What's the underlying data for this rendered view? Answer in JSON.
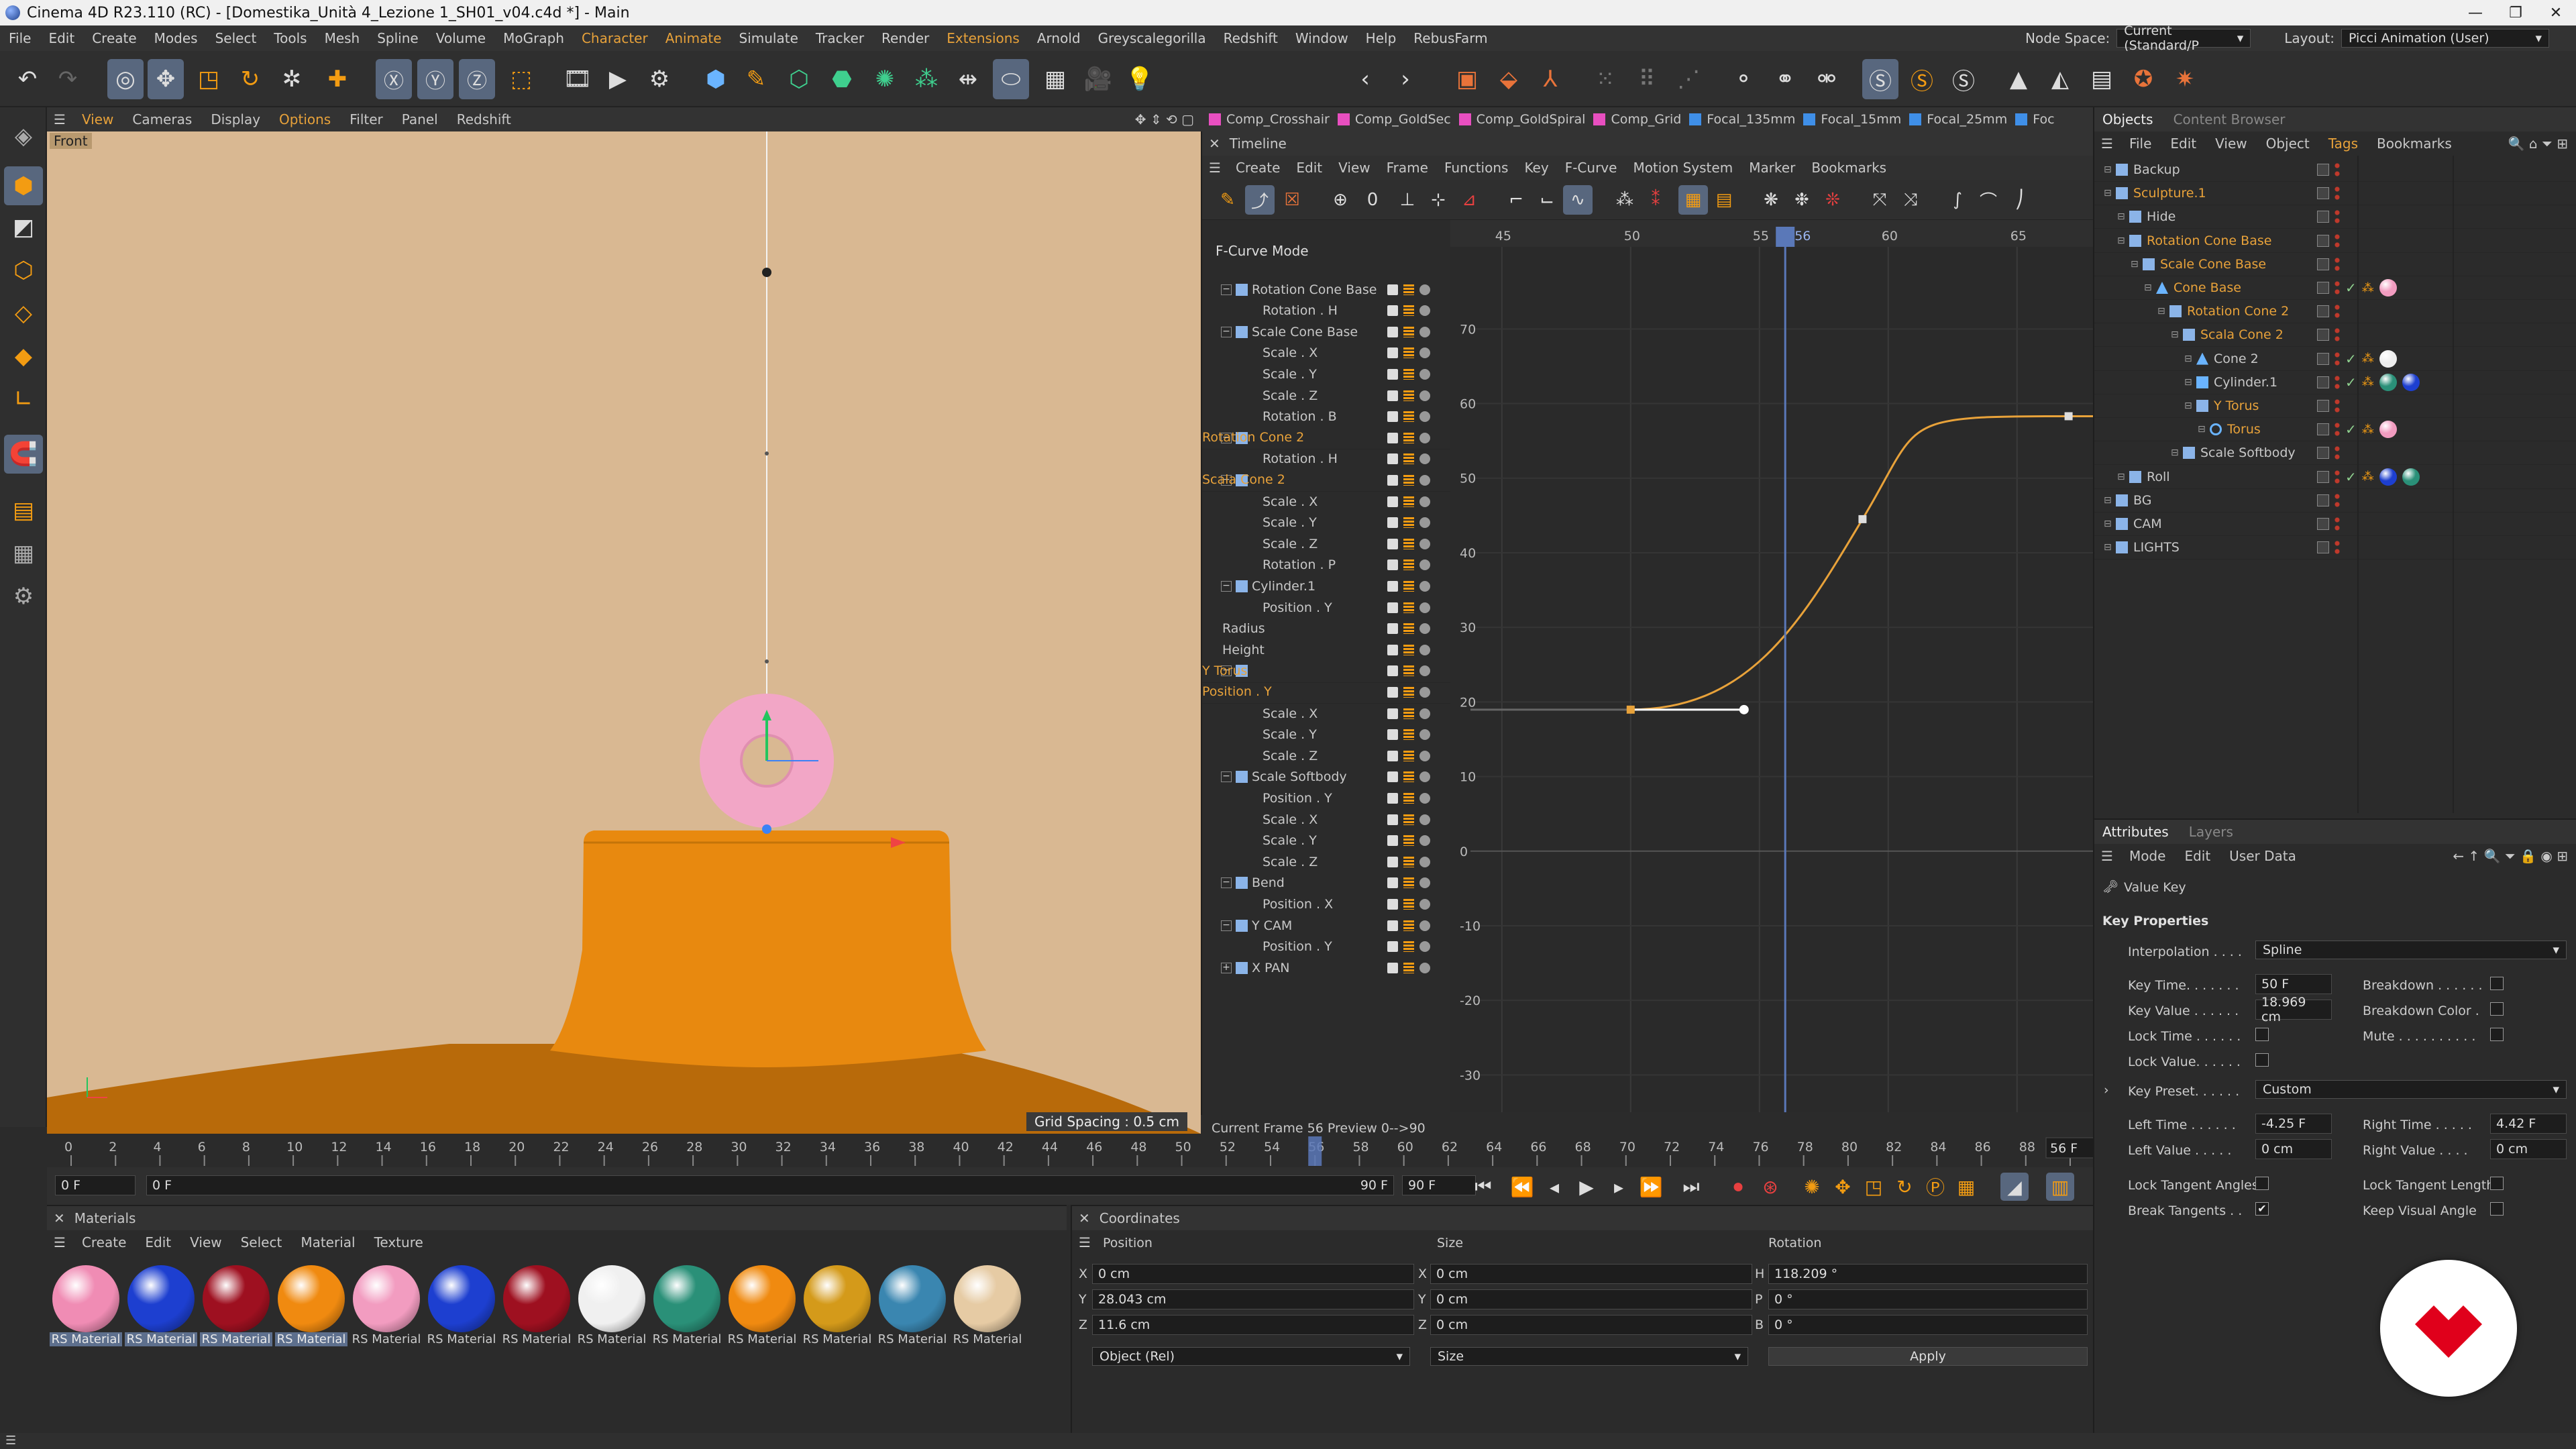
{
  "window": {
    "title": "Cinema 4D R23.110 (RC) - [Domestika_Unità 4_Lezione 1_SH01_v04.c4d *] - Main"
  },
  "menubar": {
    "items": [
      "File",
      "Edit",
      "Create",
      "Modes",
      "Select",
      "Tools",
      "Mesh",
      "Spline",
      "Volume",
      "MoGraph",
      "Character",
      "Animate",
      "Simulate",
      "Tracker",
      "Render",
      "Extensions",
      "Arnold",
      "Greyscalegorilla",
      "Redshift",
      "Window",
      "Help",
      "RebusFarm"
    ],
    "node_space_label": "Node Space:",
    "node_space_value": "Current (Standard/P",
    "layout_label": "Layout:",
    "layout_value": "Picci Animation (User)"
  },
  "viewport": {
    "menu": [
      "View",
      "Cameras",
      "Display",
      "Options",
      "Filter",
      "Panel",
      "Redshift"
    ],
    "view_name": "Front",
    "grid_spacing": "Grid Spacing : 0.5 cm",
    "bg_color": "#d9b892",
    "torus_color": "#f2a6c6",
    "base_color": "#e8890f"
  },
  "tabs": [
    "Comp_Crosshair",
    "Comp_GoldSec",
    "Comp_GoldSpiral",
    "Comp_Grid",
    "Focal_135mm",
    "Focal_15mm",
    "Focal_25mm",
    "Foc"
  ],
  "timeline": {
    "title": "Timeline",
    "menu": [
      "Create",
      "Edit",
      "View",
      "Frame",
      "Functions",
      "Key",
      "F-Curve",
      "Motion System",
      "Marker",
      "Bookmarks"
    ],
    "mode": "F-Curve Mode",
    "tracks": [
      {
        "name": "Rotation Cone Base",
        "level": 0,
        "exp": "−",
        "obj": true,
        "color": "n"
      },
      {
        "name": "Rotation . H",
        "level": 1
      },
      {
        "name": "Scale Cone Base",
        "level": 0,
        "exp": "−",
        "obj": true,
        "color": "n"
      },
      {
        "name": "Scale . X",
        "level": 1
      },
      {
        "name": "Scale . Y",
        "level": 1
      },
      {
        "name": "Scale . Z",
        "level": 1
      },
      {
        "name": "Rotation . B",
        "level": 1
      },
      {
        "name": "Rotation Cone 2",
        "level": 0,
        "exp": "−",
        "obj": true,
        "color": "o"
      },
      {
        "name": "Rotation . H",
        "level": 1
      },
      {
        "name": "Scala Cone 2",
        "level": 0,
        "exp": "−",
        "obj": true,
        "color": "o"
      },
      {
        "name": "Scale . X",
        "level": 1
      },
      {
        "name": "Scale . Y",
        "level": 1
      },
      {
        "name": "Scale . Z",
        "level": 1
      },
      {
        "name": "Rotation . P",
        "level": 1
      },
      {
        "name": "Cylinder.1",
        "level": 0,
        "exp": "−",
        "obj": true,
        "color": "n"
      },
      {
        "name": "Position . Y",
        "level": 1
      },
      {
        "name": "Radius",
        "level": 2
      },
      {
        "name": "Height",
        "level": 2
      },
      {
        "name": "Y Torus",
        "level": 0,
        "exp": "−",
        "obj": true,
        "color": "o"
      },
      {
        "name": "Position . Y",
        "level": 1,
        "color": "o"
      },
      {
        "name": "Scale . X",
        "level": 1
      },
      {
        "name": "Scale . Y",
        "level": 1
      },
      {
        "name": "Scale . Z",
        "level": 1
      },
      {
        "name": "Scale Softbody",
        "level": 0,
        "exp": "−",
        "obj": true,
        "color": "n"
      },
      {
        "name": "Position . Y",
        "level": 1
      },
      {
        "name": "Scale . X",
        "level": 1
      },
      {
        "name": "Scale . Y",
        "level": 1
      },
      {
        "name": "Scale . Z",
        "level": 1
      },
      {
        "name": "Bend",
        "level": 0,
        "exp": "−",
        "obj": true,
        "color": "n"
      },
      {
        "name": "Position . X",
        "level": 1
      },
      {
        "name": "Y CAM",
        "level": 0,
        "exp": "−",
        "obj": true,
        "color": "n"
      },
      {
        "name": "Position . Y",
        "level": 1
      },
      {
        "name": "X PAN",
        "level": 0,
        "exp": "+",
        "obj": true,
        "color": "n"
      }
    ],
    "current_frame_text": "Current Frame  56  Preview  0-->90",
    "graph": {
      "x_ticks": [
        45,
        50,
        55,
        60,
        65
      ],
      "y_ticks": [
        70,
        60,
        50,
        40,
        30,
        20,
        10,
        0,
        -10,
        -20,
        -30
      ],
      "x_range": [
        43,
        68
      ],
      "y_range": [
        -35,
        81
      ],
      "current_frame": 56,
      "playhead_label": "56",
      "curve_color": "#e8a23a",
      "keys": [
        {
          "frame": 50,
          "value": 18.969
        },
        {
          "frame": 59,
          "value": 44.5
        },
        {
          "frame": 67,
          "value": 58.3
        }
      ],
      "tangent_handle": {
        "frame": 54.4,
        "value": 18.969
      }
    }
  },
  "scrubber": {
    "ticks": [
      0,
      2,
      4,
      6,
      8,
      10,
      12,
      14,
      16,
      18,
      20,
      22,
      24,
      26,
      28,
      30,
      32,
      34,
      36,
      38,
      40,
      42,
      44,
      46,
      48,
      50,
      52,
      54,
      56,
      58,
      60,
      62,
      64,
      66,
      68,
      70,
      72,
      74,
      76,
      78,
      80,
      82,
      84,
      86,
      88,
      90
    ],
    "range": [
      0,
      90
    ],
    "current_frame": 56,
    "current_label": "56 F",
    "start_field": "0 F",
    "start_field2": "0 F",
    "end_field": "90 F",
    "end_field2": "90 F"
  },
  "materials": {
    "title": "Materials",
    "menu": [
      "Create",
      "Edit",
      "View",
      "Select",
      "Material",
      "Texture"
    ],
    "items": [
      {
        "label": "RS Material",
        "color": "#f08cb4",
        "sel": true
      },
      {
        "label": "RS Material",
        "color": "#1d3fd0",
        "sel": true
      },
      {
        "label": "RS Material",
        "color": "#9e1020",
        "sel": true
      },
      {
        "label": "RS Material",
        "color": "#f08a10",
        "sel": true
      },
      {
        "label": "RS Material",
        "color": "#f29cc0",
        "sel": false
      },
      {
        "label": "RS Material",
        "color": "#1d3fd0",
        "sel": false
      },
      {
        "label": "RS Material",
        "color": "#9e1020",
        "sel": false
      },
      {
        "label": "RS Material",
        "color": "#f0f0f0",
        "sel": false
      },
      {
        "label": "RS Material",
        "color": "#2a9078",
        "sel": false
      },
      {
        "label": "RS Material",
        "color": "#f08a10",
        "sel": false
      },
      {
        "label": "RS Material",
        "color": "#d49a1a",
        "sel": false
      },
      {
        "label": "RS Material",
        "color": "#3a86b0",
        "sel": false
      },
      {
        "label": "RS Material",
        "color": "#e6cba4",
        "sel": false
      }
    ]
  },
  "coordinates": {
    "title": "Coordinates",
    "headers": {
      "position": "Position",
      "size": "Size",
      "rotation": "Rotation"
    },
    "rows": [
      {
        "axis": "X",
        "pos": "0 cm",
        "size_axis": "X",
        "size": "0 cm",
        "rot_axis": "H",
        "rot": "118.209 °"
      },
      {
        "axis": "Y",
        "pos": "28.043 cm",
        "size_axis": "Y",
        "size": "0 cm",
        "rot_axis": "P",
        "rot": "0 °"
      },
      {
        "axis": "Z",
        "pos": "11.6 cm",
        "size_axis": "Z",
        "size": "0 cm",
        "rot_axis": "B",
        "rot": "0 °"
      }
    ],
    "mode_select": "Object (Rel)",
    "size_select": "Size",
    "apply": "Apply"
  },
  "objects": {
    "tabs": [
      "Objects",
      "Content Browser"
    ],
    "menu": [
      "File",
      "Edit",
      "View",
      "Object",
      "Tags",
      "Bookmarks"
    ],
    "rows": [
      {
        "name": "Backup",
        "level": 0,
        "ico": "null",
        "o": false,
        "tags": []
      },
      {
        "name": "Sculpture.1",
        "level": 0,
        "ico": "null",
        "o": true,
        "tags": []
      },
      {
        "name": "Hide",
        "level": 1,
        "ico": "null",
        "o": false,
        "tags": []
      },
      {
        "name": "Rotation Cone Base",
        "level": 1,
        "ico": "null",
        "o": true,
        "tags": []
      },
      {
        "name": "Scale Cone Base",
        "level": 2,
        "ico": "null",
        "o": true,
        "tags": []
      },
      {
        "name": "Cone Base",
        "level": 3,
        "ico": "cone",
        "o": true,
        "check": true,
        "tags": [
          "#f29cc0"
        ]
      },
      {
        "name": "Rotation Cone 2",
        "level": 4,
        "ico": "null",
        "o": true,
        "tags": []
      },
      {
        "name": "Scala Cone 2",
        "level": 5,
        "ico": "null",
        "o": true,
        "tags": []
      },
      {
        "name": "Cone 2",
        "level": 6,
        "ico": "cone",
        "o": false,
        "check": true,
        "tags": [
          "#eeeeee"
        ]
      },
      {
        "name": "Cylinder.1",
        "level": 6,
        "ico": "cyl",
        "o": false,
        "check": true,
        "tags": [
          "#2a9078",
          "#1d3fd0"
        ]
      },
      {
        "name": "Y Torus",
        "level": 6,
        "ico": "null",
        "o": true,
        "tags": []
      },
      {
        "name": "Torus",
        "level": 7,
        "ico": "torus",
        "o": true,
        "check": true,
        "tags": [
          "#f29cc0"
        ]
      },
      {
        "name": "Scale Softbody",
        "level": 5,
        "ico": "null",
        "o": false,
        "tags": []
      },
      {
        "name": "Roll",
        "level": 1,
        "ico": "null",
        "o": false,
        "check": true,
        "tags": [
          "#1d3fd0",
          "#2a9078"
        ]
      },
      {
        "name": "BG",
        "level": 0,
        "ico": "null",
        "o": false,
        "tags": []
      },
      {
        "name": "CAM",
        "level": 0,
        "ico": "null",
        "o": false,
        "tags": []
      },
      {
        "name": "LIGHTS",
        "level": 0,
        "ico": "null",
        "o": false,
        "tags": []
      }
    ]
  },
  "attributes": {
    "tabs": [
      "Attributes",
      "Layers"
    ],
    "menu": [
      "Mode",
      "Edit",
      "User Data"
    ],
    "header": "Value Key",
    "section": "Key Properties",
    "interpolation_label": "Interpolation . . . .",
    "interpolation_value": "Spline",
    "key_time_label": "Key Time. . . . . . .",
    "key_time_value": "50 F",
    "key_value_label": "Key Value . . . . . .",
    "key_value_value": "18.969 cm",
    "lock_time_label": "Lock Time . . . . . .",
    "lock_value_label": "Lock Value. . . . . .",
    "breakdown_label": "Breakdown . . . . . .",
    "breakdown_color_label": "Breakdown Color .",
    "mute_label": "Mute . . . . . . . . . .",
    "key_preset_label": "Key Preset. . . . . .",
    "key_preset_value": "Custom",
    "left_time_label": "Left  Time . . . . . .",
    "left_time_value": "-4.25 F",
    "right_time_label": "Right Time . . . . .",
    "right_time_value": "4.42 F",
    "left_value_label": "Left  Value . . . . .",
    "left_value_value": "0 cm",
    "right_value_label": "Right Value . . . .",
    "right_value_value": "0 cm",
    "lock_tangent_angles_label": "Lock Tangent Angles",
    "lock_tangent_lengths_label": "Lock Tangent Lengths",
    "break_tangents_label": "Break Tangents . .",
    "keep_visual_angle_label": "Keep Visual Angle"
  }
}
